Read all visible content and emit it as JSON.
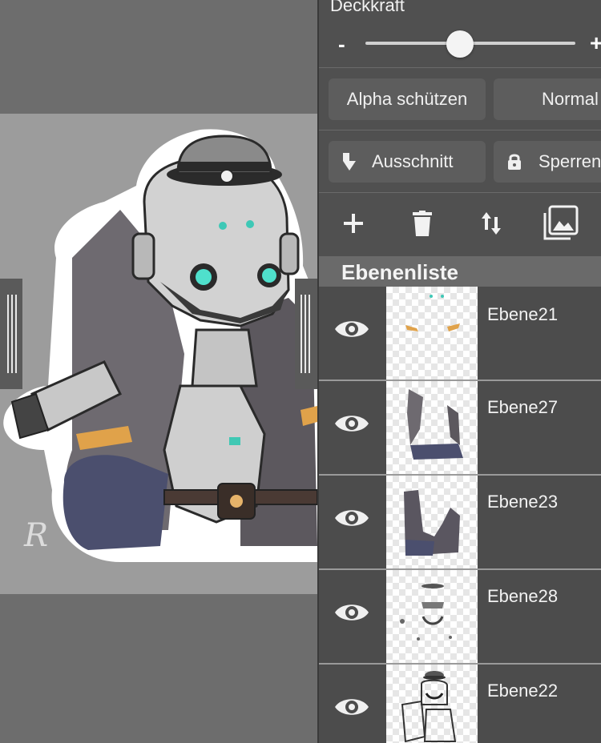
{
  "canvas": {
    "doc_color": "#9c9c9c",
    "signature": "R"
  },
  "panel": {
    "opacity_label": "Deckkraft",
    "slider_minus": "-",
    "slider_plus": "+",
    "opacity_value": 0.45,
    "alpha_lock_label": "Alpha schützen",
    "blend_mode_label": "Normal",
    "clipping_label": "Ausschnitt",
    "lock_label": "Sperren",
    "layer_list_title": "Ebenenliste",
    "layers": [
      {
        "name": "Ebene21"
      },
      {
        "name": "Ebene27"
      },
      {
        "name": "Ebene23"
      },
      {
        "name": "Ebene28"
      },
      {
        "name": "Ebene22"
      }
    ],
    "tools": [
      "add-icon",
      "trash-icon",
      "move-layer-icon",
      "image-stack-icon"
    ]
  }
}
